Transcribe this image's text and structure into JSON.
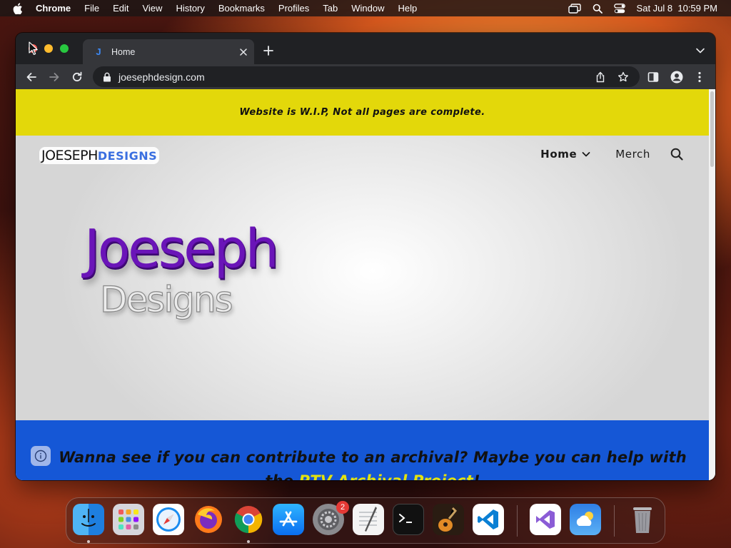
{
  "menubar": {
    "app_name": "Chrome",
    "items": [
      "File",
      "Edit",
      "View",
      "History",
      "Bookmarks",
      "Profiles",
      "Tab",
      "Window",
      "Help"
    ],
    "clock": "Sat Jul 8  10:59 PM"
  },
  "browser": {
    "tab_title": "Home",
    "favicon_letter": "J",
    "url": "joesephdesign.com"
  },
  "site": {
    "notice": "Website is W.I.P, Not all pages are complete.",
    "logo_part1": "JOESEPH",
    "logo_part2": "DESIGNS",
    "nav_home": "Home",
    "nav_merch": "Merch",
    "hero_title": "Joeseph",
    "hero_subtitle": "Designs",
    "banner_text_main": "Wanna see if you can contribute to an archival? Maybe you can help with the ",
    "banner_link": "PTV Archival Project",
    "banner_text_end": "!"
  },
  "dock": {
    "apps": [
      "Finder",
      "Launchpad",
      "Safari",
      "Firefox",
      "Google Chrome",
      "App Store",
      "System Settings",
      "TextEdit",
      "Terminal",
      "GarageBand",
      "Visual Studio Code",
      "Visual Studio",
      "Weather",
      "Trash"
    ],
    "settings_badge": "2"
  },
  "colors": {
    "notice_bg": "#e3d80a",
    "banner_bg": "#1557d6",
    "banner_link": "#e3e20d",
    "hero_title": "#6a14b8",
    "logo_accent": "#3a6fe0"
  }
}
